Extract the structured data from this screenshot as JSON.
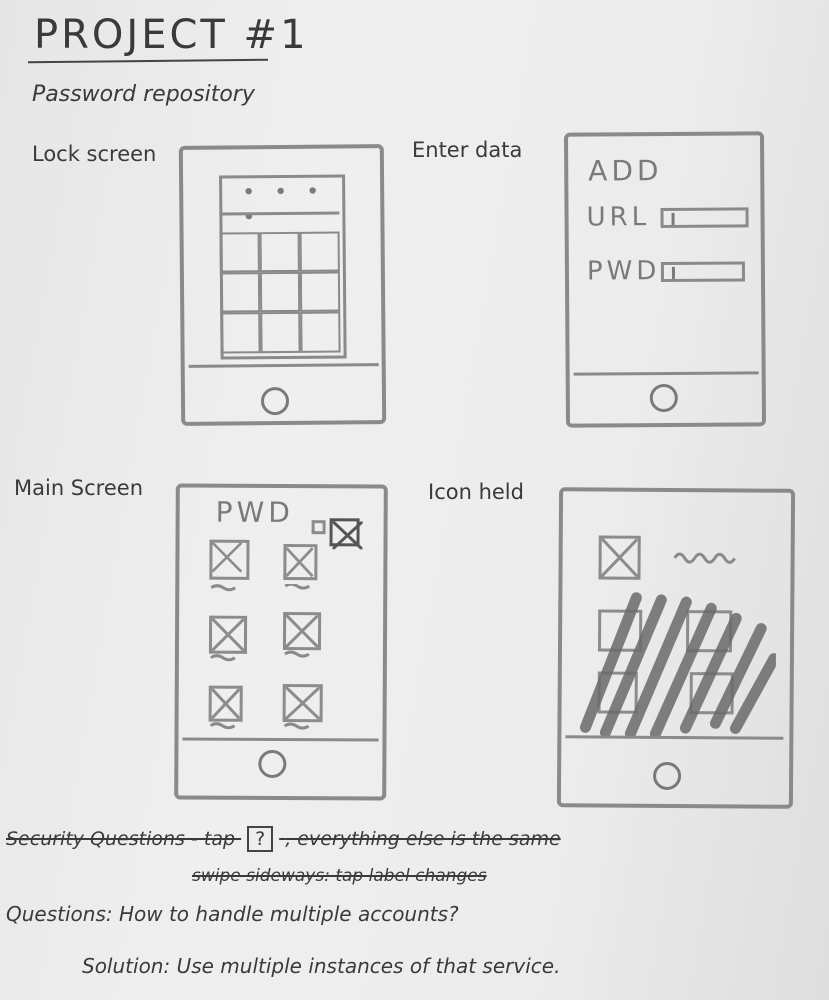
{
  "title": "PROJECT #1",
  "subtitle": "Password repository",
  "screens": {
    "lock": {
      "label": "Lock screen",
      "dots": "• • • •"
    },
    "enter": {
      "label": "Enter data",
      "heading": "ADD",
      "url_label": "URL",
      "pwd_label": "PWD"
    },
    "main": {
      "label": "Main Screen",
      "heading": "PWD"
    },
    "held": {
      "label": "Icon held"
    }
  },
  "notes": {
    "security_prefix": "Security Questions - tap",
    "security_icon": "?",
    "security_suffix": ", everything else is the same",
    "swipe": "swipe sideways: tap label changes",
    "questions": "Questions: How to handle multiple accounts?",
    "solution": "Solution: Use multiple instances of that service."
  },
  "icons": [
    "placeholder-image-icon",
    "delete-icon",
    "home-button-icon"
  ]
}
